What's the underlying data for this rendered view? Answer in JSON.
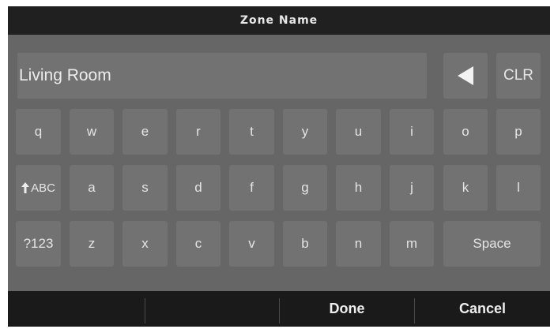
{
  "header": {
    "title": "Zone Name"
  },
  "entry": {
    "value": "Living Room"
  },
  "controls": {
    "backspace_icon": "triangle-left-icon",
    "clear_label": "CLR"
  },
  "keyboard": {
    "row1": [
      "q",
      "w",
      "e",
      "r",
      "t",
      "y",
      "u",
      "i",
      "o",
      "p"
    ],
    "row2": [
      "a",
      "s",
      "d",
      "f",
      "g",
      "h",
      "j",
      "k",
      "l"
    ],
    "row3": [
      "z",
      "x",
      "c",
      "v",
      "b",
      "n",
      "m"
    ],
    "shift_label": "ABC",
    "shift_icon": "arrow-up-icon",
    "symbols_label": "?123",
    "space_label": "Space"
  },
  "footer": {
    "done_label": "Done",
    "cancel_label": "Cancel"
  },
  "colors": {
    "screen_bg": "#666666",
    "key_bg": "#727272",
    "bar_bg": "#202020"
  }
}
